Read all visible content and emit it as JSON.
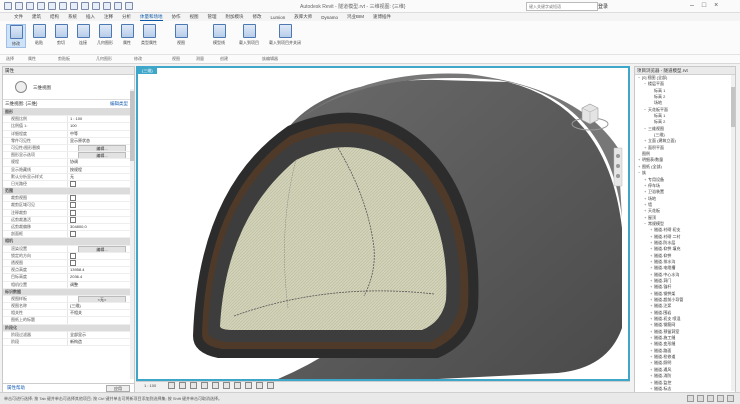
{
  "title_bar": {
    "window_title": "Autodesk Revit - 隧道模型.rvt - 三维视图: {三维}",
    "search_placeholder": "键入关键字或短语",
    "user": "登录",
    "controls": [
      "–",
      "□",
      "×"
    ]
  },
  "ribbon_tabs": [
    "文件",
    "建筑",
    "结构",
    "系统",
    "插入",
    "注释",
    "分析",
    "体量和场地",
    "协作",
    "视图",
    "管理",
    "附加模块",
    "修改",
    "Lumion",
    "族库大师",
    "Dynamo",
    "鸿业BIM",
    "速博插件"
  ],
  "active_tab": "体量和场地",
  "ribbon": {
    "buttons": [
      "修改",
      "粘贴",
      "剪切",
      "连接",
      "几何图形",
      "填充",
      "属性",
      "类型属性",
      "移动",
      "复制",
      "旋转",
      "阵列",
      "视图",
      "测量",
      "创建",
      "模型线",
      "编辑族",
      "载入到项目",
      "载入到项目并关闭"
    ],
    "groups": [
      "选择",
      "属性",
      "剪贴板",
      "几何图形",
      "修改",
      "视图",
      "测量",
      "创建",
      "族编辑器"
    ]
  },
  "properties": {
    "header": "属性",
    "type_name": "三维视图",
    "selector_label": "三维视图: {三维}",
    "edit_type": "编辑类型",
    "rows": [
      {
        "group": true,
        "k": "图形",
        "v": ""
      },
      {
        "k": "视图比例",
        "v": "1 : 100"
      },
      {
        "k": "比例值 1:",
        "v": "100"
      },
      {
        "k": "详细程度",
        "v": "中等"
      },
      {
        "k": "零件可见性",
        "v": "显示原状态"
      },
      {
        "k": "可见性/图形替换",
        "v": "编辑...",
        "btn": true
      },
      {
        "k": "图形显示选项",
        "v": "编辑...",
        "btn": true
      },
      {
        "k": "规程",
        "v": "协调"
      },
      {
        "k": "显示隐藏线",
        "v": "按规程"
      },
      {
        "k": "默认分析显示样式",
        "v": "无"
      },
      {
        "k": "日光路径",
        "v": "",
        "chk": true
      },
      {
        "group": true,
        "k": "范围",
        "v": ""
      },
      {
        "k": "裁剪视图",
        "v": "",
        "chk": true
      },
      {
        "k": "裁剪区域可见",
        "v": "",
        "chk": true
      },
      {
        "k": "注释裁剪",
        "v": "",
        "chk": true
      },
      {
        "k": "远剪裁激活",
        "v": "",
        "chk": true
      },
      {
        "k": "远剪裁偏移",
        "v": "304800.0"
      },
      {
        "k": "剖面框",
        "v": "",
        "chk": true
      },
      {
        "group": true,
        "k": "相机",
        "v": ""
      },
      {
        "k": "渲染设置",
        "v": "编辑...",
        "btn": true
      },
      {
        "k": "锁定的方向",
        "v": "",
        "chk": true
      },
      {
        "k": "透视图",
        "v": "",
        "chk": true
      },
      {
        "k": "视点高度",
        "v": "13958.4"
      },
      {
        "k": "目标高度",
        "v": "2036.4"
      },
      {
        "k": "相机位置",
        "v": "调整"
      },
      {
        "group": true,
        "k": "标识数据",
        "v": ""
      },
      {
        "k": "视图样板",
        "v": "<无>",
        "btn": true
      },
      {
        "k": "视图名称",
        "v": "{三维}"
      },
      {
        "k": "相关性",
        "v": "不相关"
      },
      {
        "k": "图纸上的标题",
        "v": ""
      },
      {
        "group": true,
        "k": "阶段化",
        "v": ""
      },
      {
        "k": "阶段过滤器",
        "v": "全部显示"
      },
      {
        "k": "阶段",
        "v": "新构造"
      }
    ],
    "help_link": "属性帮助",
    "apply": "应用"
  },
  "viewport": {
    "tab_label": "{三维}",
    "scale": "1 : 100",
    "colors": {
      "shell": "#5b5b5b",
      "lining": "#4f3a2a",
      "inner": "#cfcfb4",
      "frame": "#3ea7c9"
    }
  },
  "project_browser": {
    "header": "项目浏览器 - 隧道模型.rvt",
    "items": [
      {
        "t": "−",
        "label": "[0] 视图 (全部)",
        "lvl": 0
      },
      {
        "t": "−",
        "label": "楼层平面",
        "lvl": 1
      },
      {
        "t": "",
        "label": "标高 1",
        "lvl": 2
      },
      {
        "t": "",
        "label": "标高 2",
        "lvl": 2
      },
      {
        "t": "",
        "label": "场地",
        "lvl": 2
      },
      {
        "t": "−",
        "label": "天花板平面",
        "lvl": 1
      },
      {
        "t": "",
        "label": "标高 1",
        "lvl": 2
      },
      {
        "t": "",
        "label": "标高 2",
        "lvl": 2
      },
      {
        "t": "−",
        "label": "三维视图",
        "lvl": 1
      },
      {
        "t": "",
        "label": "{三维}",
        "lvl": 2
      },
      {
        "t": "+",
        "label": "立面 (建筑立面)",
        "lvl": 1
      },
      {
        "t": "+",
        "label": "面积平面",
        "lvl": 1
      },
      {
        "t": "",
        "label": "图例",
        "lvl": 0
      },
      {
        "t": "+",
        "label": "明细表/数量",
        "lvl": 0
      },
      {
        "t": "+",
        "label": "图纸 (全部)",
        "lvl": 0
      },
      {
        "t": "−",
        "label": "族",
        "lvl": 0
      },
      {
        "t": "+",
        "label": "专用设备",
        "lvl": 1
      },
      {
        "t": "+",
        "label": "停车场",
        "lvl": 1
      },
      {
        "t": "+",
        "label": "卫浴装置",
        "lvl": 1
      },
      {
        "t": "+",
        "label": "场地",
        "lvl": 1
      },
      {
        "t": "+",
        "label": "墙",
        "lvl": 1
      },
      {
        "t": "+",
        "label": "天花板",
        "lvl": 1
      },
      {
        "t": "+",
        "label": "屋顶",
        "lvl": 1
      },
      {
        "t": "−",
        "label": "常规模型",
        "lvl": 1
      },
      {
        "t": "+",
        "label": "隧道-衬砌 初支",
        "lvl": 2
      },
      {
        "t": "+",
        "label": "隧道-衬砌 二衬",
        "lvl": 2
      },
      {
        "t": "+",
        "label": "隧道-防水层",
        "lvl": 2
      },
      {
        "t": "+",
        "label": "隧道-仰拱 填充",
        "lvl": 2
      },
      {
        "t": "+",
        "label": "隧道-仰拱",
        "lvl": 2
      },
      {
        "t": "+",
        "label": "隧道-排水沟",
        "lvl": 2
      },
      {
        "t": "+",
        "label": "隧道-电缆槽",
        "lvl": 2
      },
      {
        "t": "+",
        "label": "隧道-中心水沟",
        "lvl": 2
      },
      {
        "t": "+",
        "label": "隧道-洞门",
        "lvl": 2
      },
      {
        "t": "+",
        "label": "隧道-锚杆",
        "lvl": 2
      },
      {
        "t": "+",
        "label": "隧道-钢拱架",
        "lvl": 2
      },
      {
        "t": "+",
        "label": "隧道-超前小导管",
        "lvl": 2
      },
      {
        "t": "+",
        "label": "隧道-注浆",
        "lvl": 2
      },
      {
        "t": "+",
        "label": "隧道-围岩",
        "lvl": 2
      },
      {
        "t": "+",
        "label": "隧道-初支 喷混",
        "lvl": 2
      },
      {
        "t": "+",
        "label": "隧道-钢筋网",
        "lvl": 2
      },
      {
        "t": "+",
        "label": "隧道-预留洞室",
        "lvl": 2
      },
      {
        "t": "+",
        "label": "隧道-施工缝",
        "lvl": 2
      },
      {
        "t": "+",
        "label": "隧道-变形缝",
        "lvl": 2
      },
      {
        "t": "+",
        "label": "隧道-路面",
        "lvl": 2
      },
      {
        "t": "+",
        "label": "隧道-检修道",
        "lvl": 2
      },
      {
        "t": "+",
        "label": "隧道-照明",
        "lvl": 2
      },
      {
        "t": "+",
        "label": "隧道-通风",
        "lvl": 2
      },
      {
        "t": "+",
        "label": "隧道-消防",
        "lvl": 2
      },
      {
        "t": "+",
        "label": "隧道-监控",
        "lvl": 2
      },
      {
        "t": "+",
        "label": "隧道-标志",
        "lvl": 2
      }
    ]
  },
  "status": {
    "text": "单击可进行选择; 按 Tab 键并单击可选择其他项目; 按 Ctrl 键并单击可将新项目添加到选择集; 按 Shift 键并单击可取消选择。"
  }
}
